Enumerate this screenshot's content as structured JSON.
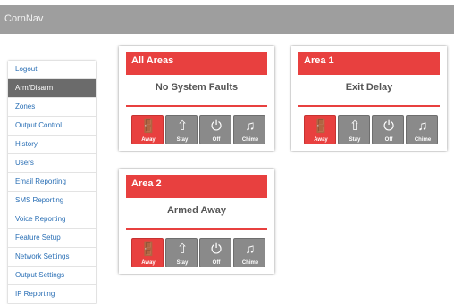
{
  "app": {
    "title": "CornNav"
  },
  "sidebar": {
    "items": [
      {
        "label": "Logout"
      },
      {
        "label": "Arm/Disarm"
      },
      {
        "label": "Zones"
      },
      {
        "label": "Output Control"
      },
      {
        "label": "History"
      },
      {
        "label": "Users"
      },
      {
        "label": "Email Reporting"
      },
      {
        "label": "SMS Reporting"
      },
      {
        "label": "Voice Reporting"
      },
      {
        "label": "Feature Setup"
      },
      {
        "label": "Network Settings"
      },
      {
        "label": "Output Settings"
      },
      {
        "label": "IP Reporting"
      }
    ],
    "active_item": "Arm/Disarm"
  },
  "areas": [
    {
      "title": "All Areas",
      "status": "No System Faults",
      "buttons": [
        {
          "label": "Away",
          "icon": "door-exit-icon",
          "active": true
        },
        {
          "label": "Stay",
          "icon": "house-icon",
          "active": false
        },
        {
          "label": "Off",
          "icon": "power-icon",
          "active": false
        },
        {
          "label": "Chime",
          "icon": "music-note-icon",
          "active": false
        }
      ]
    },
    {
      "title": "Area 1",
      "status": "Exit Delay",
      "buttons": [
        {
          "label": "Away",
          "icon": "door-exit-icon",
          "active": true
        },
        {
          "label": "Stay",
          "icon": "house-icon",
          "active": false
        },
        {
          "label": "Off",
          "icon": "power-icon",
          "active": false
        },
        {
          "label": "Chime",
          "icon": "music-note-icon",
          "active": false
        }
      ]
    },
    {
      "title": "Area 2",
      "status": "Armed Away",
      "buttons": [
        {
          "label": "Away",
          "icon": "door-exit-icon",
          "active": true
        },
        {
          "label": "Stay",
          "icon": "house-icon",
          "active": false
        },
        {
          "label": "Off",
          "icon": "power-icon",
          "active": false
        },
        {
          "label": "Chime",
          "icon": "music-note-icon",
          "active": false
        }
      ]
    }
  ],
  "colors": {
    "accent": "#e8403f",
    "topbar": "#9e9e9e",
    "button_gray": "#8a8a8a",
    "sidebar_active": "#6b6b6b",
    "link": "#2a6fb5"
  }
}
